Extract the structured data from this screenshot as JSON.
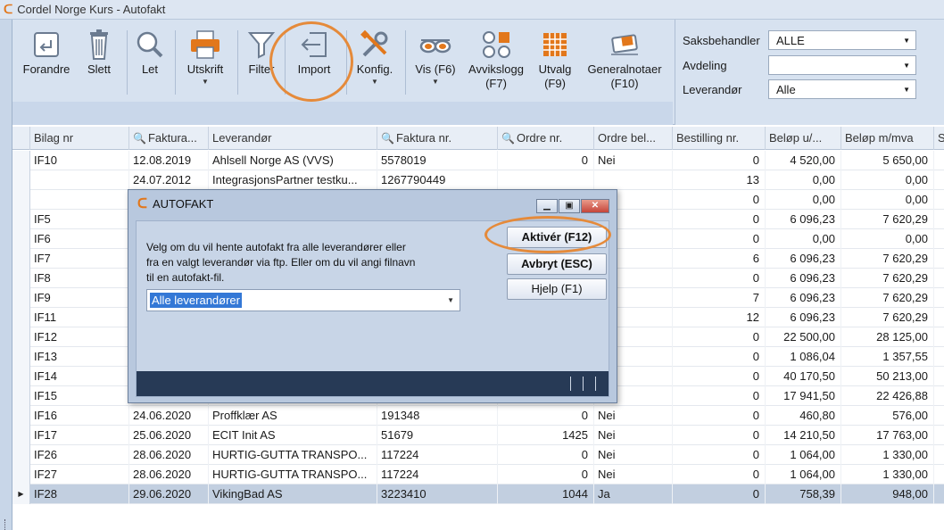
{
  "window": {
    "title": "Cordel Norge Kurs - Autofakt"
  },
  "toolbar": {
    "forandre": "Forandre",
    "slett": "Slett",
    "let": "Let",
    "utskrift": "Utskrift",
    "filter": "Filter",
    "import": "Import",
    "konfig": "Konfig.",
    "vis": "Vis (F6)",
    "avvikslogg_1": "Avvikslogg",
    "avvikslogg_2": "(F7)",
    "utvalg_1": "Utvalg",
    "utvalg_2": "(F9)",
    "generalnotaer_1": "Generalnotaer",
    "generalnotaer_2": "(F10)"
  },
  "filters": {
    "saksbehandler_label": "Saksbehandler",
    "saksbehandler_value": "ALLE",
    "avdeling_label": "Avdeling",
    "avdeling_value": "",
    "leverandor_label": "Leverandør",
    "leverandor_value": "Alle"
  },
  "grid": {
    "columns": [
      "Bilag nr",
      "Faktura...",
      "Leverandør",
      "Faktura nr.",
      "Ordre nr.",
      "Ordre bel...",
      "Bestilling nr.",
      "Beløp u/...",
      "Beløp m/mva",
      "S"
    ],
    "rows": [
      {
        "bilag": "IF10",
        "dato": "12.08.2019",
        "lev": "Ahlsell Norge AS (VVS)",
        "fnr": "5578019",
        "ordre": "0",
        "obel": "Nei",
        "best": "0",
        "u": "4 520,00",
        "m": "5 650,00"
      },
      {
        "bilag": "",
        "dato": "24.07.2012",
        "lev": "IntegrasjonsPartner testku...",
        "fnr": "1267790449",
        "ordre": "",
        "obel": "",
        "best": "13",
        "u": "0,00",
        "m": "0,00"
      },
      {
        "bilag": "",
        "dato": "",
        "lev": "",
        "fnr": "",
        "ordre": "",
        "obel": "",
        "best": "0",
        "u": "0,00",
        "m": "0,00"
      },
      {
        "bilag": "IF5",
        "dato": "",
        "lev": "",
        "fnr": "",
        "ordre": "",
        "obel": "",
        "best": "0",
        "u": "6 096,23",
        "m": "7 620,29"
      },
      {
        "bilag": "IF6",
        "dato": "",
        "lev": "",
        "fnr": "",
        "ordre": "",
        "obel": "",
        "best": "0",
        "u": "0,00",
        "m": "0,00"
      },
      {
        "bilag": "IF7",
        "dato": "",
        "lev": "",
        "fnr": "",
        "ordre": "",
        "obel": "",
        "best": "6",
        "u": "6 096,23",
        "m": "7 620,29"
      },
      {
        "bilag": "IF8",
        "dato": "",
        "lev": "",
        "fnr": "",
        "ordre": "",
        "obel": "",
        "best": "0",
        "u": "6 096,23",
        "m": "7 620,29"
      },
      {
        "bilag": "IF9",
        "dato": "",
        "lev": "",
        "fnr": "",
        "ordre": "",
        "obel": "",
        "best": "7",
        "u": "6 096,23",
        "m": "7 620,29"
      },
      {
        "bilag": "IF11",
        "dato": "",
        "lev": "",
        "fnr": "",
        "ordre": "",
        "obel": "",
        "best": "12",
        "u": "6 096,23",
        "m": "7 620,29"
      },
      {
        "bilag": "IF12",
        "dato": "",
        "lev": "",
        "fnr": "",
        "ordre": "",
        "obel": "",
        "best": "0",
        "u": "22 500,00",
        "m": "28 125,00"
      },
      {
        "bilag": "IF13",
        "dato": "",
        "lev": "",
        "fnr": "",
        "ordre": "",
        "obel": "",
        "best": "0",
        "u": "1 086,04",
        "m": "1 357,55"
      },
      {
        "bilag": "IF14",
        "dato": "",
        "lev": "",
        "fnr": "",
        "ordre": "",
        "obel": "",
        "best": "0",
        "u": "40 170,50",
        "m": "50 213,00"
      },
      {
        "bilag": "IF15",
        "dato": "",
        "lev": "",
        "fnr": "",
        "ordre": "",
        "obel": "",
        "best": "0",
        "u": "17 941,50",
        "m": "22 426,88"
      },
      {
        "bilag": "IF16",
        "dato": "24.06.2020",
        "lev": "Proffklær AS",
        "fnr": "191348",
        "ordre": "0",
        "obel": "Nei",
        "best": "0",
        "u": "460,80",
        "m": "576,00"
      },
      {
        "bilag": "IF17",
        "dato": "25.06.2020",
        "lev": "ECIT Init AS",
        "fnr": "51679",
        "ordre": "1425",
        "obel": "Nei",
        "best": "0",
        "u": "14 210,50",
        "m": "17 763,00"
      },
      {
        "bilag": "IF26",
        "dato": "28.06.2020",
        "lev": "HURTIG-GUTTA TRANSPO...",
        "fnr": "117224",
        "ordre": "0",
        "obel": "Nei",
        "best": "0",
        "u": "1 064,00",
        "m": "1 330,00"
      },
      {
        "bilag": "IF27",
        "dato": "28.06.2020",
        "lev": "HURTIG-GUTTA TRANSPO...",
        "fnr": "117224",
        "ordre": "0",
        "obel": "Nei",
        "best": "0",
        "u": "1 064,00",
        "m": "1 330,00"
      },
      {
        "bilag": "IF28",
        "dato": "29.06.2020",
        "lev": "VikingBad AS",
        "fnr": "3223410",
        "ordre": "1044",
        "obel": "Ja",
        "best": "0",
        "u": "758,39",
        "m": "948,00"
      }
    ]
  },
  "dialog": {
    "title": "AUTOFAKT",
    "message_1": "Velg om du vil hente autofakt fra alle leverandører eller",
    "message_2": "fra en valgt leverandør via ftp. Eller om du vil angi filnavn",
    "message_3": "til en autofakt-fil.",
    "select_value": "Alle leverandører",
    "activate_button": "Aktivér (F12)",
    "cancel_button": "Avbryt (ESC)",
    "help_button": "Hjelp (F1)"
  },
  "colors": {
    "accent": "#e58a3a",
    "brand": "#e2771b",
    "selection": "#c2cfe0",
    "dialog_bottom": "#273a56"
  }
}
